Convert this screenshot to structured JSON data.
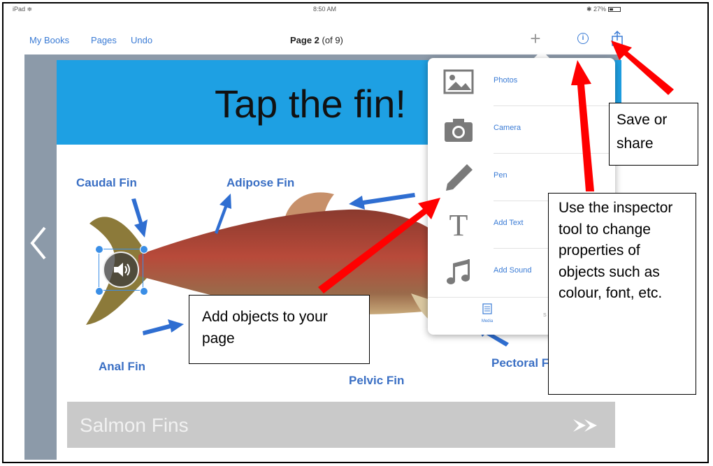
{
  "status_bar": {
    "device": "iPad ≑",
    "time": "8:50 AM",
    "battery": "✱ 27%"
  },
  "nav": {
    "my_books": "My Books",
    "pages": "Pages",
    "undo": "Undo",
    "title_bold": "Page 2",
    "title_rest": " (of 9)",
    "plus_label": "+",
    "info_label": "i"
  },
  "page": {
    "heading": "Tap the fin!",
    "fin_labels": {
      "caudal": "Caudal Fin",
      "adipose": "Adipose Fin",
      "anal": "Anal Fin",
      "pelvic": "Pelvic Fin",
      "pectoral": "Pectoral Fi"
    },
    "footer_title": "Salmon Fins"
  },
  "popover": {
    "items": [
      {
        "label": "Photos",
        "icon": "photos-icon"
      },
      {
        "label": "Camera",
        "icon": "camera-icon"
      },
      {
        "label": "Pen",
        "icon": "pen-icon"
      },
      {
        "label": "Add Text",
        "icon": "text-icon"
      },
      {
        "label": "Add Sound",
        "icon": "music-note-icon"
      }
    ],
    "tab_media": "Media",
    "tab_other": "S"
  },
  "annotations": {
    "save_share": "Save or share",
    "inspector": "Use the inspector tool to change properties of objects such as colour, font, etc.",
    "add_objects": "Add objects to your page"
  },
  "colors": {
    "banner": "#1ea0e3",
    "link": "#3a7bd5",
    "arrow_red": "#ff0000",
    "canvas_bg": "#8c9aa9"
  }
}
